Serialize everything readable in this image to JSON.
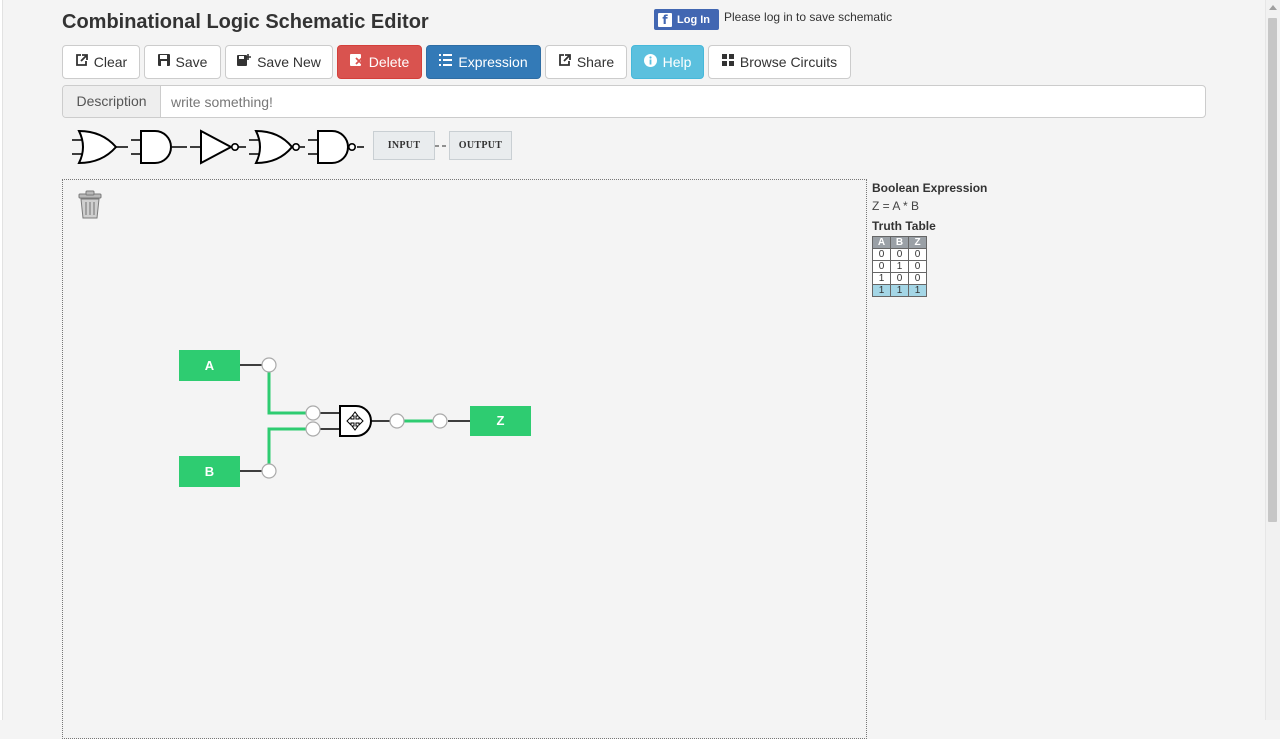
{
  "title": "Combinational Logic Schematic Editor",
  "facebook": {
    "button_label": "Log In",
    "icon": "facebook-icon"
  },
  "login_note": "Please log in to save schematic",
  "toolbar": {
    "clear": "Clear",
    "save": "Save",
    "save_new": "Save New",
    "delete": "Delete",
    "expression": "Expression",
    "share": "Share",
    "help": "Help",
    "browse": "Browse Circuits"
  },
  "colors": {
    "danger": "#d9534f",
    "primary": "#337ab7",
    "info": "#5bc0de",
    "node_green": "#2ecc71",
    "wire_green": "#2ecc71"
  },
  "description": {
    "label": "Description",
    "placeholder": "write something!"
  },
  "palette": {
    "gates": [
      "OR",
      "AND",
      "NOT",
      "NOR",
      "NAND"
    ],
    "input_label": "INPUT",
    "output_label": "OUTPUT"
  },
  "circuit": {
    "inputs": [
      "A",
      "B"
    ],
    "gate": "AND",
    "output": "Z"
  },
  "sidebar": {
    "expr_title": "Boolean Expression",
    "expression": "Z = A * B",
    "truth_title": "Truth Table",
    "truth_table": {
      "headers": [
        "A",
        "B",
        "Z"
      ],
      "rows": [
        [
          "0",
          "0",
          "0"
        ],
        [
          "0",
          "1",
          "0"
        ],
        [
          "1",
          "0",
          "0"
        ],
        [
          "1",
          "1",
          "1"
        ]
      ],
      "highlighted_row": 3
    }
  }
}
